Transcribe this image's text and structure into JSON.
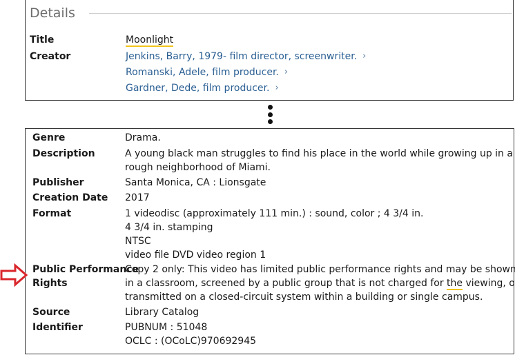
{
  "details": {
    "heading": "Details",
    "title_label": "Title",
    "title_value": "Moonlight",
    "creator_label": "Creator",
    "creators": [
      "Jenkins, Barry, 1979- film director, screenwriter.",
      "Romanski, Adele, film producer.",
      "Gardner, Dede, film producer."
    ],
    "chevron": "›"
  },
  "record": {
    "genre_label": "Genre",
    "genre": "Drama.",
    "description_label": "Description",
    "description_lines": [
      "A young black man struggles to find his place in the world while growing up in a",
      "rough neighborhood of Miami."
    ],
    "publisher_label": "Publisher",
    "publisher": "Santa Monica, CA : Lionsgate",
    "creation_date_label": "Creation Date",
    "creation_date": "2017",
    "format_label": "Format",
    "format_lines": [
      "1 videodisc (approximately 111 min.) : sound, color ; 4 3/4 in.",
      "4 3/4 in. stamping",
      "NTSC",
      "video file DVD video region 1"
    ],
    "rights_label_line1": "Public Performance",
    "rights_label_line2": "Rights",
    "rights_line1": "Copy 2 only: This video has limited public performance rights and may be shown",
    "rights_line2_before": "in a classroom, screened by a public group that is not charged for ",
    "rights_line2_highlight": "the",
    "rights_line2_after": " viewing, or",
    "rights_line3": "transmitted on a closed-circuit system within a building or single campus.",
    "source_label": "Source",
    "source": "Library Catalog",
    "identifier_label": "Identifier",
    "identifiers": [
      "PUBNUM : 51048",
      "OCLC : (OCoLC)970692945"
    ]
  },
  "colors": {
    "link": "#2a5f93",
    "highlight_underline": "#f0c419",
    "arrow": "#d9262b"
  },
  "icons": {
    "separator": "vertical-ellipsis-icon",
    "pointer": "red-arrow-icon",
    "creator_link": "chevron-right-icon"
  }
}
